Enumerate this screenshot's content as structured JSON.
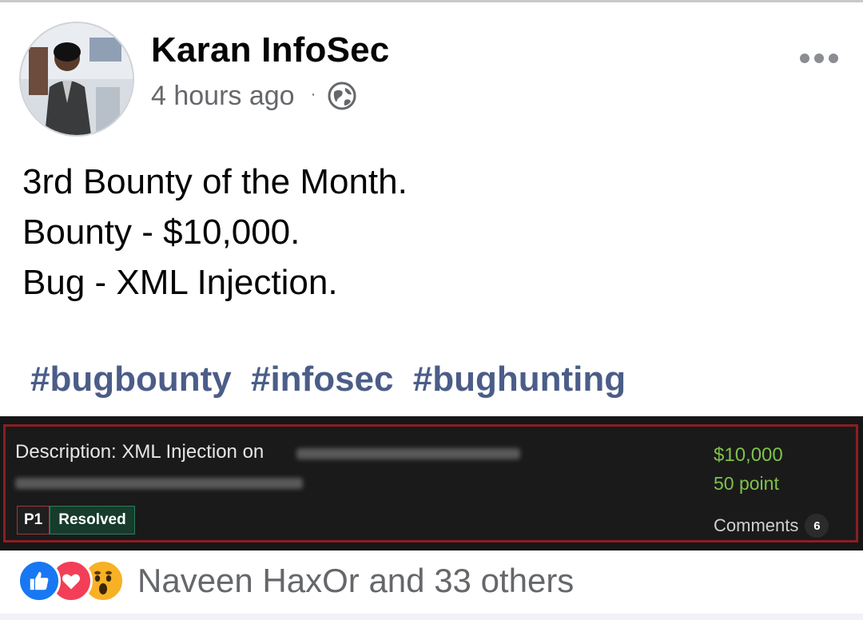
{
  "post": {
    "author": "Karan InfoSec",
    "timestamp": "4 hours ago",
    "separator": "·",
    "audience_icon": "globe-icon",
    "more_icon": "more-horizontal-icon",
    "lines": [
      "3rd Bounty of the Month.",
      "Bounty - $10,000.",
      "Bug - XML Injection."
    ],
    "hashtags": [
      "#bugbounty",
      "#infosec",
      "#bughunting"
    ]
  },
  "attachment": {
    "description": "Description: XML Injection on",
    "priority": "P1",
    "status": "Resolved",
    "amount": "$10,000",
    "points": "50 point",
    "comments_label": "Comments",
    "comments_count": "6"
  },
  "reactions": {
    "icons": [
      "like-icon",
      "love-icon",
      "wow-icon"
    ],
    "summary": "Naveen HaxOr and 33 others"
  },
  "colors": {
    "hashtag": "#4b5d88",
    "amount_green": "#7ec24a",
    "card_border": "#8b1e22",
    "like_blue": "#1877f2",
    "love_red": "#f33e58",
    "wow_yellow": "#f7b125"
  }
}
